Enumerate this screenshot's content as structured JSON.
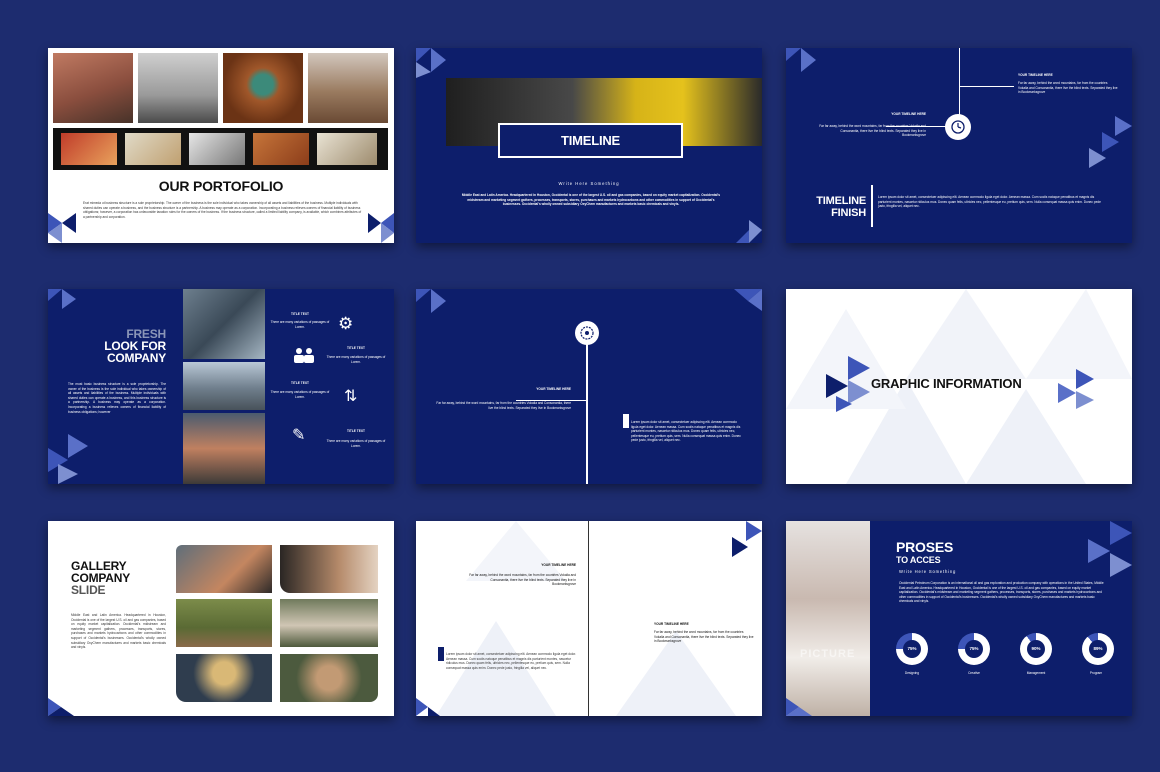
{
  "colors": {
    "page_bg": "#1d2c6f",
    "navy": "#0d1e6b",
    "accent": "#3d55b8",
    "white": "#ffffff"
  },
  "slide1": {
    "title": "OUR PORTOFOLIO",
    "body": "Erat mimeda ut business structure is a sole proprietorship. The owner of the business is the sole individual who takes ownership of all assets and liabilities of the business. Multiple individuals with shared duties can operate a business, and the business structure is a partnership. A business may operate as a corporation. Incorporating a business relieves owners of financial liability of business obligations; however, a corporation has unfavorable taxation rules for the owners of the business. If the business structure, called a limited liability company, is available, which combines attributes of a partnership and corporation."
  },
  "slide2": {
    "title": "TIMELINE",
    "subtitle": "Write Here Something",
    "body": "Middle East and Latin America. Headquartered in Houston, Occidental is one of the largest U.S. oil and gas companies, based on equity market capitalization. Occidental's midstream and marketing segment gathers, processes, transports, stores, purchases and markets hydrocarbons and other commodities in support of Occidental's businesses. Occidental's wholly owned subsidiary OxyChem manufactures and markets basic chemicals and vinyls."
  },
  "slide3": {
    "top_heading": "YOUR TIMELINE HERE",
    "top_body": "Far far away, behind the word mountains, far from the countries Vokalia and Consonantia, there live the blind texts. Separated they live in Bookmarksgrove",
    "left_heading": "YOUR TIMELINE HERE",
    "left_body": "Far far away, behind the word mountains, far from the countries Vokalia and Consonantia, there live the blind texts. Separated they live in Bookmarksgrove",
    "finish_line1": "TIMELINE",
    "finish_line2": "FINISH",
    "finish_body": "Lorem ipsum dolor sit amet, consectetuer adipiscing elit. Aenean commodo ligula eget dolor. Aenean massa. Cum sociis natoque penatibus et magnis dis parturient montes, nascetur ridiculus mus. Donec quam felis, ultricies nec, pellentesque eu, pretium quis, sem. Nulla consequat massa quis enim. Donec pede justo, fringilla vel, aliquet nec."
  },
  "slide4": {
    "line1": "FRESH",
    "line2": "LOOK FOR",
    "line3": "COMPANY",
    "body": "The most basic business structure is a sole proprietorship. The owner of the business is the sole individual who takes ownership of all assets and liabilities of the business. Multiple individuals with shared duties can operate a business, and this business structure is a partnership. A business may operate as a corporation. Incorporating a business relieves owners of financial liability of business obligations; however",
    "items": [
      {
        "title": "TITLE TEXT",
        "body": "There are many variations of passages of Lorem."
      },
      {
        "title": "TITLE TEXT",
        "body": "There are many variations of passages of Lorem."
      },
      {
        "title": "TITLE TEXT",
        "body": "There are many variations of passages of Lorem."
      },
      {
        "title": "TITLE TEXT",
        "body": "There are many variations of passages of Lorem."
      }
    ],
    "icons": [
      "gears-icon",
      "people-icon",
      "arrows-icon",
      "pencil-icon"
    ]
  },
  "slide5": {
    "heading": "YOUR TIMELINE HERE",
    "body": "Far far away, behind the word mountains, far from the countries Vokalia and Consonantia, there live the blind texts. Separated they live in Bookmarksgrove",
    "right_body": "Lorem ipsum dolor sit amet, consectetuer adipiscing elit. Aenean commodo ligula eget dolor. Aenean massa. Cum sociis natoque penatibus et magnis dis parturient montes, nascetur ridiculus mus. Donec quam felis, ultricies nec, pellentesque eu, pretium quis, sem. Nulla consequat massa quis enim. Donec pede justo, fringilla vel, aliquet nec."
  },
  "slide6": {
    "title": "GRAPHIC INFORMATION"
  },
  "slide7": {
    "line1": "GALLERY",
    "line2": "COMPANY",
    "line3": "SLIDE",
    "body": "Middle East and Latin America. Headquartered in Houston, Occidental is one of the largest U.S. oil and gas companies, based on equity market capitalization. Occidental's midstream and marketing segment gathers, processes, transports, stores, purchases and markets hydrocarbons and other commodities in support of Occidental's businesses. Occidental's wholly owned subsidiary OxyChem manufactures and markets basic chemicals and vinyls."
  },
  "slide8": {
    "top_heading": "YOUR TIMELINE HERE",
    "top_body": "Far far away, behind the word mountains, far from the countries Vokalia and Consonantia, there live the blind texts. Separated they live in Bookmarksgrove",
    "right_heading": "YOUR TIMELINE HERE",
    "right_body": "Far far away, behind the word mountains, far from the countries Vokalia and Consonantia, there live the blind texts. Separated they live in Bookmarksgrove",
    "left_body": "Lorem ipsum dolor sit amet, consectetuer adipiscing elit. Aenean commodo ligula eget dolor. Aenean massa. Cum sociis natoque penatibus et magnis dis parturient montes, nascetur ridiculus mus. Donec quam felis, ultricies nec, pellentesque eu, pretium quis, sem. Nulla consequat massa quis enim. Donec pede justo, fringilla vel, aliquet nec."
  },
  "slide9": {
    "title": "PROSES",
    "subtitle": "TO ACCES",
    "tagline": "Write Here Something",
    "watermark": "PICTURE",
    "body": "Occidental Petroleum Corporation is an international oil and gas exploration and production company with operations in the United States, Middle East and Latin America. Headquartered in Houston, Occidental is one of the largest U.S. oil and gas companies, based on equity market capitalization. Occidental's midstream and marketing segment gathers, processes, transports, stores, purchases and markets hydrocarbons and other commodities in support of Occidental's businesses. Occidental's wholly owned subsidiary OxyChem manufactures and markets basic chemicals and vinyls.",
    "stats": [
      {
        "value": "75%",
        "label": "Designing",
        "pct": 0.75
      },
      {
        "value": "75%",
        "label": "Creative",
        "pct": 0.75
      },
      {
        "value": "90%",
        "label": "Management",
        "pct": 0.9
      },
      {
        "value": "89%",
        "label": "Program",
        "pct": 0.89
      }
    ]
  }
}
